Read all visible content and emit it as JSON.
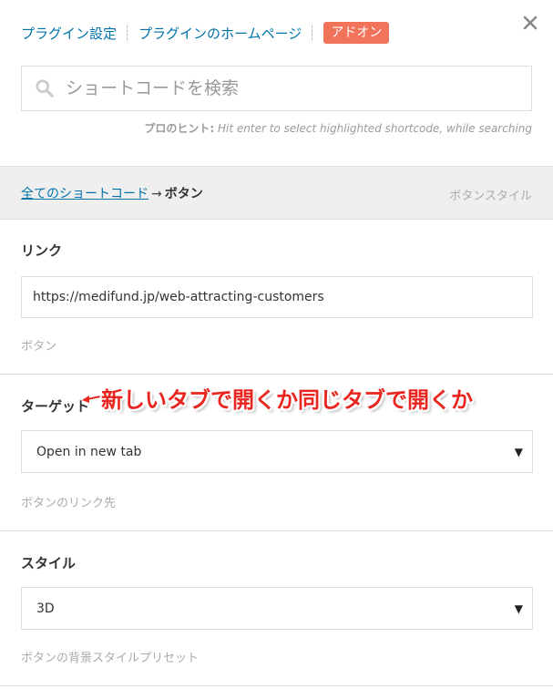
{
  "header": {
    "plugin_settings": "プラグイン設定",
    "plugin_homepage": "プラグインのホームページ",
    "addon": "アドオン"
  },
  "search": {
    "placeholder": "ショートコードを検索",
    "hint_label": "プロのヒント:",
    "hint_text": " Hit enter to select highlighted shortcode, while searching"
  },
  "breadcrumb": {
    "all_shortcodes": "全てのショートコード",
    "arrow": "→",
    "current": "ボタン",
    "right": "ボタンスタイル"
  },
  "fields": {
    "link": {
      "label": "リンク",
      "value": "https://medifund.jp/web-attracting-customers",
      "description": "ボタン"
    },
    "target": {
      "label": "ターゲット",
      "selected": "Open in new tab",
      "description": "ボタンのリンク先"
    },
    "style": {
      "label": "スタイル",
      "selected": "3D",
      "description": "ボタンの背景スタイルプリセット"
    }
  },
  "annotation": {
    "text": "新しいタブで開くか同じタブで開くか"
  },
  "icons": {
    "close": "close-icon",
    "search": "search-icon",
    "select_arrow": "▼"
  },
  "colors": {
    "link": "#0073aa",
    "addon_bg": "#f0735a",
    "annotation": "#e8261f",
    "breadcrumb_bg": "#efefef"
  }
}
